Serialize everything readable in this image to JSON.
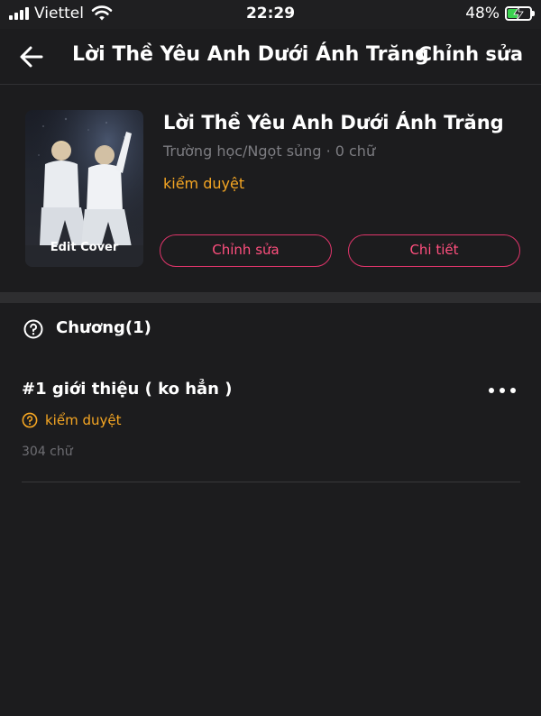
{
  "status_bar": {
    "carrier": "Viettel",
    "time": "22:29",
    "battery_percent": "48%",
    "battery_level": 0.48,
    "signal_icon": "signal-bars-icon",
    "wifi_icon": "wifi-icon",
    "battery_icon": "battery-charging-icon"
  },
  "nav": {
    "back_icon": "arrow-left-icon",
    "title": "Lời Thề Yêu Anh Dưới Ánh Trăng",
    "action": "Chỉnh sửa"
  },
  "story": {
    "cover_caption": "Edit Cover",
    "title": "Lời Thề Yêu Anh Dưới Ánh Trăng",
    "meta": "Trường học/Ngọt sủng · 0 chữ",
    "status": "kiểm duyệt",
    "edit_button": "Chỉnh sửa",
    "detail_button": "Chi tiết"
  },
  "chapters": {
    "label": "Chương(1)",
    "icon": "question-circle-icon",
    "items": [
      {
        "title": "#1 giới thiệu ( ko hẳn )",
        "status": "kiểm duyệt",
        "status_icon": "question-circle-icon",
        "words": "304 chữ",
        "menu_icon": "more-horizontal-icon"
      }
    ]
  },
  "colors": {
    "background": "#1c1c1e",
    "accent_pink": "#ff4f7e",
    "status_orange": "#f5a623",
    "muted_text": "#7d7d82",
    "battery_green": "#3bd14f"
  }
}
